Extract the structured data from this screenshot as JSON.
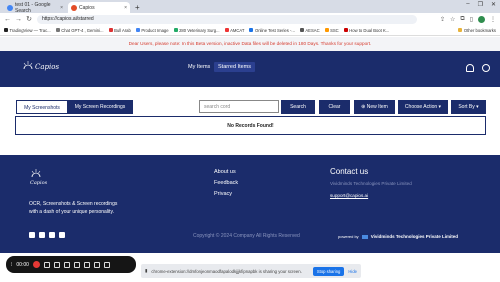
{
  "browser": {
    "tabs": [
      {
        "label": "test 01 - Google Search",
        "fav_color": "#4285f4"
      },
      {
        "label": "Capios",
        "fav_color": "#e34c26"
      }
    ],
    "url": "https://capios.ai/starred",
    "bookmarks": [
      "TradingView — Trac...",
      "Chat GPT-4 , Gemini...",
      "Bull Arab",
      "Product Image",
      "280 Veterinary Surg...",
      "AMCAT",
      "Online Test Series -...",
      "AESAC",
      "SSC",
      "How to Dual Boot K..."
    ],
    "other_bookmarks": "Other bookmarks"
  },
  "notice": "Dear Users, please note: In this Beta version, inactive Data files will be deleted in 180 Days. Thanks for your support.",
  "app": {
    "brand": "Capios",
    "nav": {
      "my_items": "My Items",
      "starred_items": "Starred Items"
    }
  },
  "toolbar": {
    "my_screenshots": "My Screenshots",
    "my_screen_recordings": "My Screen Recordings",
    "search_placeholder": "search cord",
    "search": "Search",
    "clear": "Clear",
    "new_item": "New Item",
    "choose_action": "Choose Action",
    "sort_by": "Sort By"
  },
  "empty": "No Records Found!",
  "footer": {
    "brand": "Capios",
    "tagline_1": "OCR, Screenshots & Screen recordings",
    "tagline_2": "with a dash of your unique personality.",
    "links": [
      "About us",
      "Feedback",
      "Privacy"
    ],
    "contact_title": "Contact us",
    "company": "Vividminds Technologies Private Limited",
    "email": "support@capios.ai",
    "copyright": "Copyright © 2024 Company All Rights Reserved",
    "powered_label": "powered by",
    "powered_company": "Vividminds Technologies Private Limited"
  },
  "recorder": {
    "time": "00:00"
  },
  "share": {
    "message": "chrome-extension://dmfonjeonmaodfapalodkjjjkfipnapbk is sharing your screen.",
    "stop": "Stop sharing",
    "hide": "Hide"
  }
}
